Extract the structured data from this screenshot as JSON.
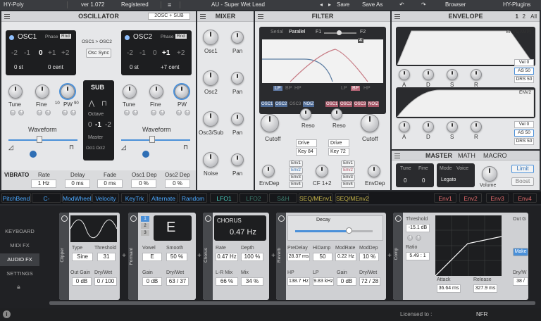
{
  "topbar": {
    "app": "HY-Poly",
    "version": "ver 1.072",
    "status": "Registered",
    "preset": "AU - Super Wet Lead",
    "save": "Save",
    "save_as": "Save As",
    "browser": "Browser",
    "brand": "HY-Plugins"
  },
  "osc": {
    "title": "OSCILLATOR",
    "mode": "2OSC + SUB",
    "osc1": {
      "name": "OSC1",
      "phase": "Phase",
      "rnd": "Rnd",
      "octave": [
        "-2",
        "-1",
        "0",
        "+1",
        "+2"
      ],
      "semi": "0 st",
      "cent": "0 cent"
    },
    "osc2": {
      "name": "OSC2",
      "phase": "Phase",
      "rnd": "Rnd",
      "octave": [
        "-2",
        "-1",
        "0",
        "+1",
        "+2"
      ],
      "semi": "0 st",
      "cent": "+7 cent"
    },
    "link": "OSC1 > OSC2",
    "sync": "Osc Sync",
    "knobs1": [
      "Tune",
      "Fine",
      "PW"
    ],
    "knobs2": [
      "Tune",
      "Fine",
      "PW"
    ],
    "pw_min": "10",
    "pw_max": "90",
    "waveform": "Waveform",
    "sub": {
      "title": "SUB",
      "octave_label": "Octave",
      "octave": [
        "0",
        "-1",
        "-2"
      ],
      "master": "Master",
      "oct": "Oct1 Oct2"
    }
  },
  "vibrato": {
    "title": "VIBRATO",
    "params": [
      {
        "label": "Rate",
        "value": "1 Hz"
      },
      {
        "label": "Delay",
        "value": "0 ms"
      },
      {
        "label": "Fade",
        "value": "0 ms"
      },
      {
        "label": "Osc1 Dep",
        "value": "0 %"
      },
      {
        "label": "Osc2 Dep",
        "value": "0 %"
      }
    ]
  },
  "mixer": {
    "title": "MIXER",
    "rows": [
      {
        "a": "Osc1",
        "b": "Pan"
      },
      {
        "a": "Osc2",
        "b": "Pan"
      },
      {
        "a": "Osc3/Sub",
        "b": "Pan"
      },
      {
        "a": "Noise",
        "b": "Pan"
      }
    ]
  },
  "filter": {
    "title": "FILTER",
    "serial": "Serial",
    "parallel": "Parallel",
    "f1": "F1",
    "f2": "F2",
    "slope": "4",
    "types1": [
      "LP",
      "BP",
      "HP"
    ],
    "types2": [
      "LP",
      "BP",
      "HP"
    ],
    "srcs1": [
      "OSC1",
      "OSC2",
      "OSC3",
      "NOIZ"
    ],
    "srcs2": [
      "OSC1",
      "OSC2",
      "OSC3",
      "NOIZ"
    ],
    "reso": "Reso",
    "cutoff": "Cutoff",
    "drive1": "Drive",
    "drive1_val": "41",
    "key1": "Key",
    "key1_val": "84",
    "drive2": "Drive",
    "drive2_val": "58",
    "key2": "Key",
    "key2_val": "72",
    "envdep": "EnvDep",
    "cf": "CF 1+2",
    "envs": [
      "Env1",
      "Env2",
      "Env3",
      "Env4"
    ]
  },
  "envelope": {
    "title": "ENVELOPE",
    "sel": [
      "1",
      "2",
      "All"
    ],
    "env1": "ENV1(AMP)",
    "env2": "ENV2",
    "adsr": [
      "A",
      "D",
      "S",
      "R"
    ],
    "vel": "Vel",
    "vel_val": "0",
    "as": "AS",
    "as_val": "50",
    "drs": "DRS",
    "drs_val": "50"
  },
  "master": {
    "tabs": [
      "MASTER",
      "MATH",
      "MACRO"
    ],
    "tune": "Tune",
    "fine": "Fine",
    "tune_val": "0",
    "fine_val": "0",
    "mode": "Mode",
    "voice": "Voice",
    "mode_val": "Legato",
    "volume": "Volume",
    "limit": "Limit",
    "boost": "Boost"
  },
  "modbar": [
    "PitchBend",
    "C-Pressure",
    "ModWheel",
    "Velocity",
    "KeyTrk",
    "Alternate",
    "Random",
    "LFO1",
    "LFO2",
    "S&H",
    "SEQ/MEnv1",
    "SEQ/MEnv2",
    "Env1",
    "Env2",
    "Env3",
    "Env4"
  ],
  "side": [
    "KEYBOARD",
    "MIDI FX",
    "AUDIO FX",
    "SETTINGS"
  ],
  "fx": {
    "clipper": {
      "title": "Clipper",
      "type": "Type",
      "type_val": "Sine",
      "thr": "Threshold",
      "thr_val": "31",
      "outgain": "Out Gain",
      "outgain_val": "0 dB",
      "drywet": "Dry/Wet",
      "drywet_val": "0 / 100"
    },
    "formant": {
      "title": "Formant",
      "slots": [
        "1",
        "2",
        "3"
      ],
      "vowel_big": "E",
      "vowel": "Vowel",
      "vowel_val": "E",
      "smooth": "Smooth",
      "smooth_val": "50 %",
      "gain": "Gain",
      "gain_val": "0 dB",
      "drywet": "Dry/Wet",
      "drywet_val": "63 / 37"
    },
    "chorus": {
      "title": "Chorus",
      "name": "CHORUS",
      "rate_big": "0.47 Hz",
      "rate": "Rate",
      "rate_val": "0.47 Hz",
      "depth": "Depth",
      "depth_val": "100 %",
      "lr": "L-R Mix",
      "lr_val": "66 %",
      "mix": "Mix",
      "mix_val": "34 %"
    },
    "reverb": {
      "title": "Reverb",
      "decay": "Decay",
      "predelay": "PreDelay",
      "predelay_val": "28.37 ms",
      "hidamp": "HiDamp",
      "hidamp_val": "50",
      "modrate": "ModRate",
      "modrate_val": "0.22 Hz",
      "moddep": "ModDep",
      "moddep_val": "10 %",
      "hp": "HP",
      "hp_val": "138.7 Hz",
      "lp": "LP",
      "lp_val": "9.83 kHz",
      "gain": "Gain",
      "gain_val": "0 dB",
      "drywet": "Dry/Wet",
      "drywet_val": "72 / 28"
    },
    "comp": {
      "title": "Comp",
      "thr": "Threshold",
      "thr_val": "-15.1 dB",
      "ratio": "Ratio",
      "ratio_val": "5.49 : 1",
      "attack": "Attack",
      "attack_val": "36.64 ms",
      "release": "Release",
      "release_val": "327.9 ms",
      "out": "Out G",
      "make": "Make",
      "drywet": "Dry/W",
      "drywet_val": "38 /"
    }
  },
  "footer": {
    "licensed": "Licensed to :",
    "user": "NFR"
  }
}
